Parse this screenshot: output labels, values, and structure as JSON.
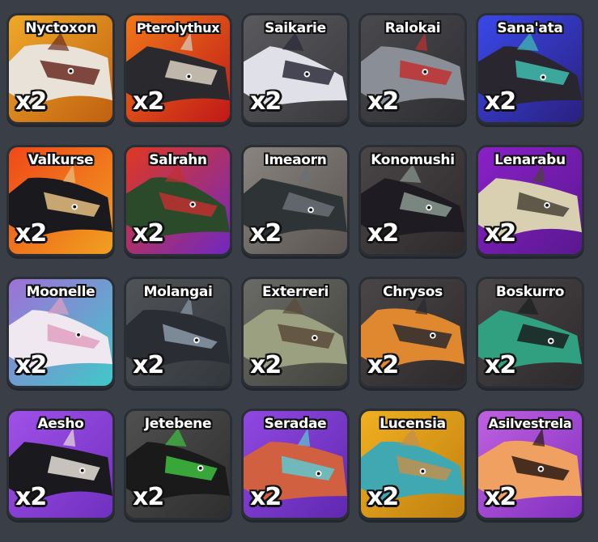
{
  "cards": [
    {
      "name": "Nyctoxon",
      "count": "x2",
      "bg": [
        "#f0a828",
        "#c06010"
      ],
      "creature": [
        "#e8e2d8",
        "#6b2c22"
      ]
    },
    {
      "name": "Pterolythux",
      "count": "x2",
      "bg": [
        "#f07818",
        "#c01818"
      ],
      "creature": [
        "#2a2a2e",
        "#d8d0c0"
      ]
    },
    {
      "name": "Saikarie",
      "count": "x2",
      "bg": [
        "#5a5a5e",
        "#3a3a3e"
      ],
      "creature": [
        "#e0e0e8",
        "#2a2a3a"
      ]
    },
    {
      "name": "Ralokai",
      "count": "x2",
      "bg": [
        "#4a4a4e",
        "#2e2e32"
      ],
      "creature": [
        "#8a8e96",
        "#c03030"
      ]
    },
    {
      "name": "Sana'ata",
      "count": "x2",
      "bg": [
        "#3a48e8",
        "#2a2080"
      ],
      "creature": [
        "#2a2630",
        "#40c0b0"
      ]
    },
    {
      "name": "Valkurse",
      "count": "x2",
      "bg": [
        "#f04818",
        "#f0a020"
      ],
      "creature": [
        "#1a1a1e",
        "#e8c080"
      ]
    },
    {
      "name": "Salrahn",
      "count": "x2",
      "bg": [
        "#e03820",
        "#7028c0"
      ],
      "creature": [
        "#2a4a2a",
        "#c03030"
      ]
    },
    {
      "name": "Imeaorn",
      "count": "x2",
      "bg": [
        "#8a8480",
        "#5a5450"
      ],
      "creature": [
        "#2e3436",
        "#6a7076"
      ]
    },
    {
      "name": "Konomushi",
      "count": "x2",
      "bg": [
        "#4a4648",
        "#2e2a2c"
      ],
      "creature": [
        "#1e1c22",
        "#8a9a90"
      ]
    },
    {
      "name": "Lenarabu",
      "count": "x2",
      "bg": [
        "#8a20c8",
        "#5a1890"
      ],
      "creature": [
        "#d8d0b0",
        "#4a4438"
      ]
    },
    {
      "name": "Moonelle",
      "count": "x2",
      "bg": [
        "#a070d8",
        "#40c8c8"
      ],
      "creature": [
        "#f0e8f0",
        "#e0a0c0"
      ]
    },
    {
      "name": "Molangai",
      "count": "x2",
      "bg": [
        "#505458",
        "#34383c"
      ],
      "creature": [
        "#2a2e34",
        "#8a9aa8"
      ]
    },
    {
      "name": "Exterreri",
      "count": "x2",
      "bg": [
        "#6a6a66",
        "#44443e"
      ],
      "creature": [
        "#9aa080",
        "#5a4a3a"
      ]
    },
    {
      "name": "Chrysos",
      "count": "x2",
      "bg": [
        "#4a4648",
        "#2e2a2c"
      ],
      "creature": [
        "#e08830",
        "#2a2a2e"
      ]
    },
    {
      "name": "Boskurro",
      "count": "x2",
      "bg": [
        "#4a4648",
        "#2e2a2c"
      ],
      "creature": [
        "#30a080",
        "#1a1e1e"
      ]
    },
    {
      "name": "Aesho",
      "count": "x2",
      "bg": [
        "#a050e8",
        "#7030c0"
      ],
      "creature": [
        "#1a1a1e",
        "#e8e0d8"
      ]
    },
    {
      "name": "Jetebene",
      "count": "x2",
      "bg": [
        "#505050",
        "#2e2e2e"
      ],
      "creature": [
        "#1a1a1a",
        "#40c040"
      ]
    },
    {
      "name": "Seradae",
      "count": "x2",
      "bg": [
        "#9048e0",
        "#6028b0"
      ],
      "creature": [
        "#d06040",
        "#60c8d0"
      ]
    },
    {
      "name": "Lucensia",
      "count": "x2",
      "bg": [
        "#f0b020",
        "#c08010"
      ],
      "creature": [
        "#40a8b0",
        "#c09050"
      ]
    },
    {
      "name": "Asilvestrela",
      "count": "x2",
      "bg": [
        "#c060e0",
        "#8030c0"
      ],
      "creature": [
        "#f0a060",
        "#2a1a14"
      ]
    }
  ]
}
